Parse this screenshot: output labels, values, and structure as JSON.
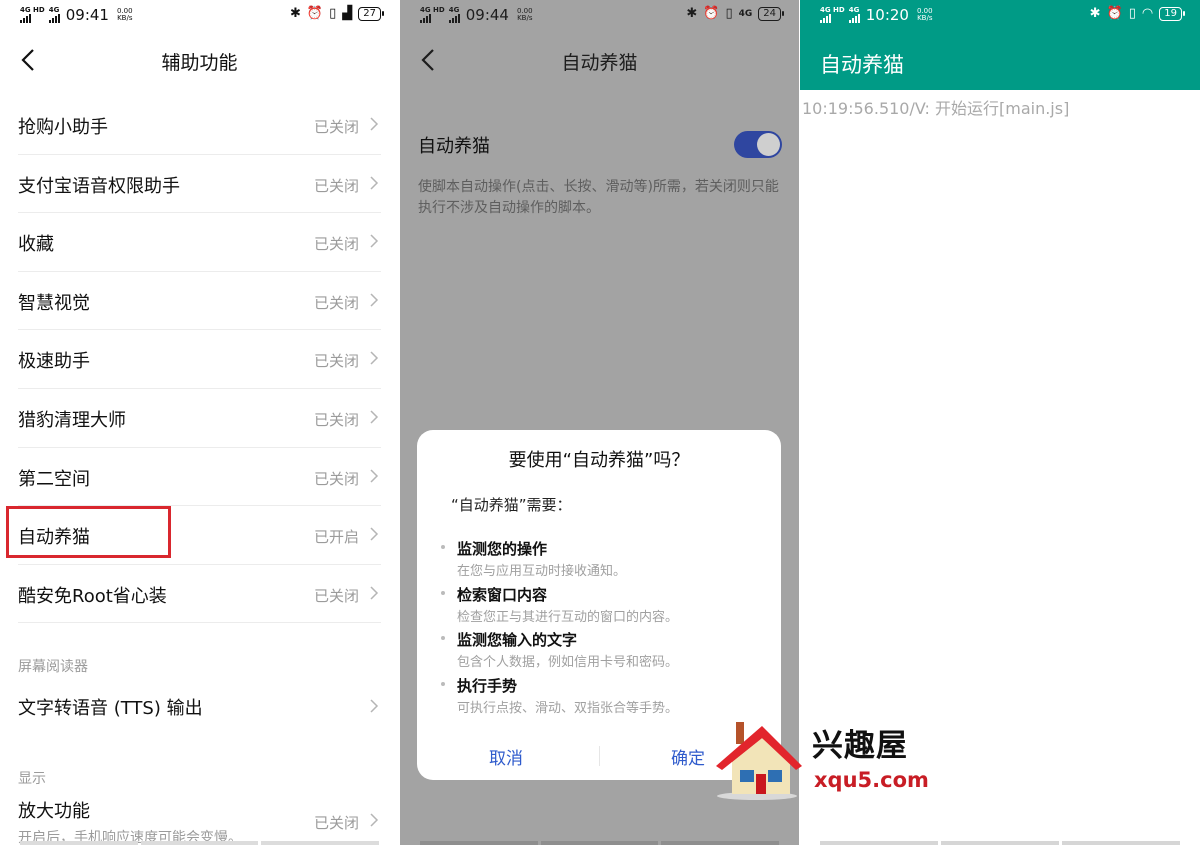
{
  "panel1": {
    "status": {
      "network": "4G HD",
      "network2": "4G",
      "time": "09:41",
      "speed": "0.00",
      "speed_unit": "KB/s",
      "battery": "27"
    },
    "title": "辅助功能",
    "items": [
      {
        "label": "抢购小助手",
        "status": "已关闭"
      },
      {
        "label": "支付宝语音权限助手",
        "status": "已关闭"
      },
      {
        "label": "收藏",
        "status": "已关闭"
      },
      {
        "label": "智慧视觉",
        "status": "已关闭"
      },
      {
        "label": "极速助手",
        "status": "已关闭"
      },
      {
        "label": "猎豹清理大师",
        "status": "已关闭"
      },
      {
        "label": "第二空间",
        "status": "已关闭"
      },
      {
        "label": "自动养猫",
        "status": "已开启"
      },
      {
        "label": "酷安免Root省心装",
        "status": "已关闭"
      }
    ],
    "section_screen_reader": "屏幕阅读器",
    "tts": "文字转语音 (TTS) 输出",
    "section_display": "显示",
    "magnify": {
      "label": "放大功能",
      "sub": "开启后，手机响应速度可能会变慢。",
      "status": "已关闭"
    },
    "highlight_color": "#d9272e"
  },
  "panel2": {
    "status": {
      "network": "4G HD",
      "network2": "4G",
      "time": "09:44",
      "speed": "0.00",
      "speed_unit": "KB/s",
      "lte": "4G",
      "battery": "24"
    },
    "title": "自动养猫",
    "toggle_label": "自动养猫",
    "toggle_on": true,
    "description": "使脚本自动操作(点击、长按、滑动等)所需，若关闭则只能执行不涉及自动操作的脚本。",
    "dialog": {
      "title": "要使用“自动养猫”吗？",
      "intro": "“自动养猫”需要：",
      "permissions": [
        {
          "title": "监测您的操作",
          "sub": "在您与应用互动时接收通知。"
        },
        {
          "title": "检索窗口内容",
          "sub": "检查您正与其进行互动的窗口的内容。"
        },
        {
          "title": "监测您输入的文字",
          "sub": "包含个人数据，例如信用卡号和密码。"
        },
        {
          "title": "执行手势",
          "sub": "可执行点按、滑动、双指张合等手势。"
        }
      ],
      "cancel": "取消",
      "confirm": "确定"
    },
    "accent_color": "#2f46a0"
  },
  "panel3": {
    "status": {
      "network": "4G HD",
      "network2": "4G",
      "time": "10:20",
      "speed": "0.00",
      "speed_unit": "KB/s",
      "battery": "19"
    },
    "app_title": "自动养猫",
    "log": "10:19:56.510/V: 开始运行[main.js]",
    "appbar_color": "#009b86"
  },
  "watermark": {
    "name": "兴趣屋",
    "url": "xqu5.com"
  }
}
